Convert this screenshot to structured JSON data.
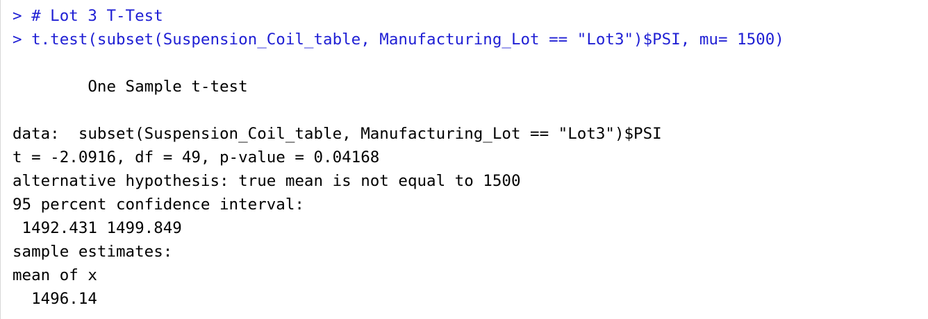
{
  "console": {
    "input_lines": [
      "> # Lot 3 T-Test",
      "> t.test(subset(Suspension_Coil_table, Manufacturing_Lot == \"Lot3\")$PSI, mu= 1500)"
    ],
    "test_title": "        One Sample t-test",
    "output_lines": [
      "data:  subset(Suspension_Coil_table, Manufacturing_Lot == \"Lot3\")$PSI",
      "t = -2.0916, df = 49, p-value = 0.04168",
      "alternative hypothesis: true mean is not equal to 1500",
      "95 percent confidence interval:",
      " 1492.431 1499.849",
      "sample estimates:",
      "mean of x",
      "  1496.14"
    ],
    "colors": {
      "input": "#1f1fd4",
      "output": "#000000",
      "background": "#ffffff"
    }
  }
}
